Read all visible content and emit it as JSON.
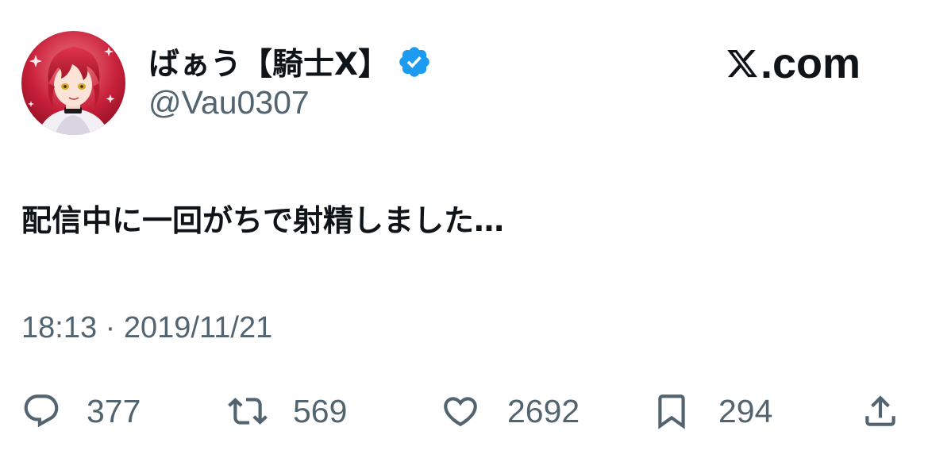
{
  "author": {
    "display_name": "ばぁう【騎士X】",
    "handle": "@Vau0307",
    "verified": true,
    "avatar_icon": "avatar-illustration"
  },
  "brand": {
    "icon": "x-logo-icon",
    "text": ".com"
  },
  "tweet": {
    "text": "配信中に一回がちで射精しました…",
    "timestamp": "18:13 · 2019/11/21"
  },
  "actions": {
    "reply": {
      "icon": "reply-icon",
      "count": "377"
    },
    "repost": {
      "icon": "repost-icon",
      "count": "569"
    },
    "like": {
      "icon": "heart-icon",
      "count": "2692"
    },
    "bookmark": {
      "icon": "bookmark-icon",
      "count": "294"
    },
    "share": {
      "icon": "share-icon"
    }
  },
  "colors": {
    "text_primary": "#0f1419",
    "text_secondary": "#536471",
    "verified_blue": "#1d9bf0",
    "background": "#ffffff"
  }
}
